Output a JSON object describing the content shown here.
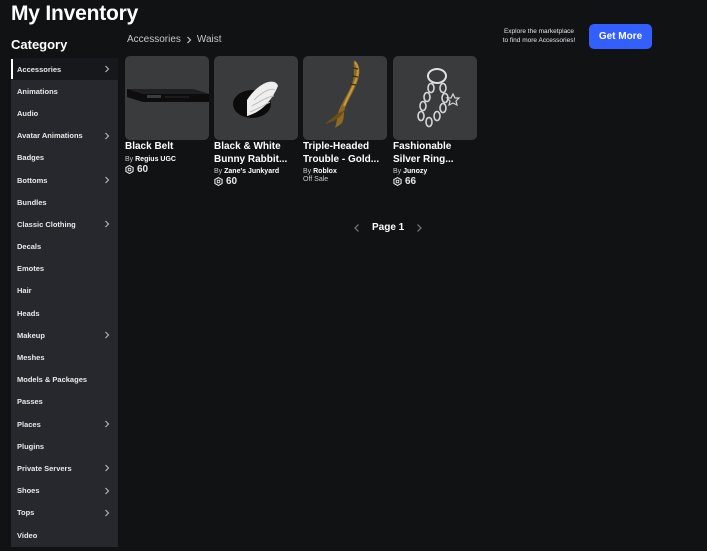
{
  "page": {
    "title": "My Inventory"
  },
  "sidebar": {
    "heading": "Category",
    "items": [
      {
        "label": "Accessories",
        "has_submenu": true,
        "active": true
      },
      {
        "label": "Animations",
        "has_submenu": false
      },
      {
        "label": "Audio",
        "has_submenu": false
      },
      {
        "label": "Avatar Animations",
        "has_submenu": true
      },
      {
        "label": "Badges",
        "has_submenu": false
      },
      {
        "label": "Bottoms",
        "has_submenu": true
      },
      {
        "label": "Bundles",
        "has_submenu": false
      },
      {
        "label": "Classic Clothing",
        "has_submenu": true
      },
      {
        "label": "Decals",
        "has_submenu": false
      },
      {
        "label": "Emotes",
        "has_submenu": false
      },
      {
        "label": "Hair",
        "has_submenu": false
      },
      {
        "label": "Heads",
        "has_submenu": false
      },
      {
        "label": "Makeup",
        "has_submenu": true
      },
      {
        "label": "Meshes",
        "has_submenu": false
      },
      {
        "label": "Models & Packages",
        "has_submenu": false
      },
      {
        "label": "Passes",
        "has_submenu": false
      },
      {
        "label": "Places",
        "has_submenu": true
      },
      {
        "label": "Plugins",
        "has_submenu": false
      },
      {
        "label": "Private Servers",
        "has_submenu": true
      },
      {
        "label": "Shoes",
        "has_submenu": true
      },
      {
        "label": "Tops",
        "has_submenu": true
      },
      {
        "label": "Video",
        "has_submenu": false
      }
    ]
  },
  "breadcrumb": {
    "parent": "Accessories",
    "current": "Waist"
  },
  "promo": {
    "text_line1": "Explore the marketplace",
    "text_line2": "to find more Accessories!",
    "button_label": "Get More"
  },
  "items": [
    {
      "name": "Black Belt",
      "by_prefix": "By",
      "creator": "Regius UGC",
      "price": "60",
      "thumb_icon": "black-belt"
    },
    {
      "name": "Black & White Bunny Rabbit...",
      "by_prefix": "By",
      "creator": "Zane's Junkyard",
      "price": "60",
      "thumb_icon": "bunny-tail"
    },
    {
      "name": "Triple-Headed Trouble - Gold...",
      "by_prefix": "By",
      "creator": "Roblox",
      "status": "Off Sale",
      "thumb_icon": "gold-horn"
    },
    {
      "name": "Fashionable Silver Ring...",
      "by_prefix": "By",
      "creator": "Junozy",
      "price": "66",
      "thumb_icon": "silver-ring-chain"
    }
  ],
  "pagination": {
    "label": "Page 1"
  },
  "colors": {
    "background": "#111214",
    "sidebar": "#26282d",
    "card": "#393b3d",
    "accent": "#335fff"
  }
}
